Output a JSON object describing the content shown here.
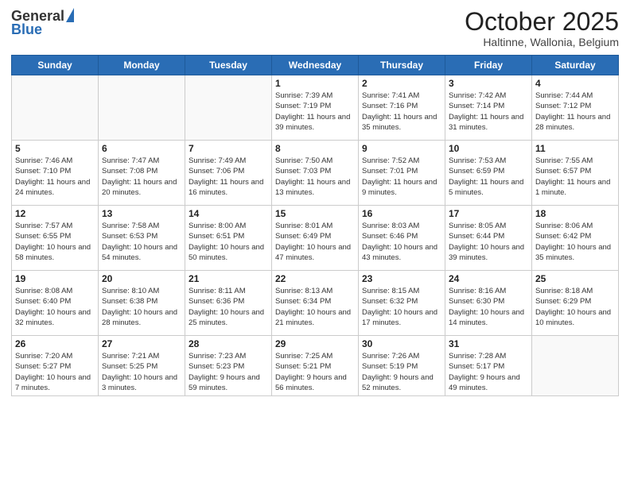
{
  "header": {
    "logo_line1": "General",
    "logo_line2": "Blue",
    "month": "October 2025",
    "location": "Haltinne, Wallonia, Belgium"
  },
  "weekdays": [
    "Sunday",
    "Monday",
    "Tuesday",
    "Wednesday",
    "Thursday",
    "Friday",
    "Saturday"
  ],
  "weeks": [
    [
      {
        "day": "",
        "sunrise": "",
        "sunset": "",
        "daylight": ""
      },
      {
        "day": "",
        "sunrise": "",
        "sunset": "",
        "daylight": ""
      },
      {
        "day": "",
        "sunrise": "",
        "sunset": "",
        "daylight": ""
      },
      {
        "day": "1",
        "sunrise": "Sunrise: 7:39 AM",
        "sunset": "Sunset: 7:19 PM",
        "daylight": "Daylight: 11 hours and 39 minutes."
      },
      {
        "day": "2",
        "sunrise": "Sunrise: 7:41 AM",
        "sunset": "Sunset: 7:16 PM",
        "daylight": "Daylight: 11 hours and 35 minutes."
      },
      {
        "day": "3",
        "sunrise": "Sunrise: 7:42 AM",
        "sunset": "Sunset: 7:14 PM",
        "daylight": "Daylight: 11 hours and 31 minutes."
      },
      {
        "day": "4",
        "sunrise": "Sunrise: 7:44 AM",
        "sunset": "Sunset: 7:12 PM",
        "daylight": "Daylight: 11 hours and 28 minutes."
      }
    ],
    [
      {
        "day": "5",
        "sunrise": "Sunrise: 7:46 AM",
        "sunset": "Sunset: 7:10 PM",
        "daylight": "Daylight: 11 hours and 24 minutes."
      },
      {
        "day": "6",
        "sunrise": "Sunrise: 7:47 AM",
        "sunset": "Sunset: 7:08 PM",
        "daylight": "Daylight: 11 hours and 20 minutes."
      },
      {
        "day": "7",
        "sunrise": "Sunrise: 7:49 AM",
        "sunset": "Sunset: 7:06 PM",
        "daylight": "Daylight: 11 hours and 16 minutes."
      },
      {
        "day": "8",
        "sunrise": "Sunrise: 7:50 AM",
        "sunset": "Sunset: 7:03 PM",
        "daylight": "Daylight: 11 hours and 13 minutes."
      },
      {
        "day": "9",
        "sunrise": "Sunrise: 7:52 AM",
        "sunset": "Sunset: 7:01 PM",
        "daylight": "Daylight: 11 hours and 9 minutes."
      },
      {
        "day": "10",
        "sunrise": "Sunrise: 7:53 AM",
        "sunset": "Sunset: 6:59 PM",
        "daylight": "Daylight: 11 hours and 5 minutes."
      },
      {
        "day": "11",
        "sunrise": "Sunrise: 7:55 AM",
        "sunset": "Sunset: 6:57 PM",
        "daylight": "Daylight: 11 hours and 1 minute."
      }
    ],
    [
      {
        "day": "12",
        "sunrise": "Sunrise: 7:57 AM",
        "sunset": "Sunset: 6:55 PM",
        "daylight": "Daylight: 10 hours and 58 minutes."
      },
      {
        "day": "13",
        "sunrise": "Sunrise: 7:58 AM",
        "sunset": "Sunset: 6:53 PM",
        "daylight": "Daylight: 10 hours and 54 minutes."
      },
      {
        "day": "14",
        "sunrise": "Sunrise: 8:00 AM",
        "sunset": "Sunset: 6:51 PM",
        "daylight": "Daylight: 10 hours and 50 minutes."
      },
      {
        "day": "15",
        "sunrise": "Sunrise: 8:01 AM",
        "sunset": "Sunset: 6:49 PM",
        "daylight": "Daylight: 10 hours and 47 minutes."
      },
      {
        "day": "16",
        "sunrise": "Sunrise: 8:03 AM",
        "sunset": "Sunset: 6:46 PM",
        "daylight": "Daylight: 10 hours and 43 minutes."
      },
      {
        "day": "17",
        "sunrise": "Sunrise: 8:05 AM",
        "sunset": "Sunset: 6:44 PM",
        "daylight": "Daylight: 10 hours and 39 minutes."
      },
      {
        "day": "18",
        "sunrise": "Sunrise: 8:06 AM",
        "sunset": "Sunset: 6:42 PM",
        "daylight": "Daylight: 10 hours and 35 minutes."
      }
    ],
    [
      {
        "day": "19",
        "sunrise": "Sunrise: 8:08 AM",
        "sunset": "Sunset: 6:40 PM",
        "daylight": "Daylight: 10 hours and 32 minutes."
      },
      {
        "day": "20",
        "sunrise": "Sunrise: 8:10 AM",
        "sunset": "Sunset: 6:38 PM",
        "daylight": "Daylight: 10 hours and 28 minutes."
      },
      {
        "day": "21",
        "sunrise": "Sunrise: 8:11 AM",
        "sunset": "Sunset: 6:36 PM",
        "daylight": "Daylight: 10 hours and 25 minutes."
      },
      {
        "day": "22",
        "sunrise": "Sunrise: 8:13 AM",
        "sunset": "Sunset: 6:34 PM",
        "daylight": "Daylight: 10 hours and 21 minutes."
      },
      {
        "day": "23",
        "sunrise": "Sunrise: 8:15 AM",
        "sunset": "Sunset: 6:32 PM",
        "daylight": "Daylight: 10 hours and 17 minutes."
      },
      {
        "day": "24",
        "sunrise": "Sunrise: 8:16 AM",
        "sunset": "Sunset: 6:30 PM",
        "daylight": "Daylight: 10 hours and 14 minutes."
      },
      {
        "day": "25",
        "sunrise": "Sunrise: 8:18 AM",
        "sunset": "Sunset: 6:29 PM",
        "daylight": "Daylight: 10 hours and 10 minutes."
      }
    ],
    [
      {
        "day": "26",
        "sunrise": "Sunrise: 7:20 AM",
        "sunset": "Sunset: 5:27 PM",
        "daylight": "Daylight: 10 hours and 7 minutes."
      },
      {
        "day": "27",
        "sunrise": "Sunrise: 7:21 AM",
        "sunset": "Sunset: 5:25 PM",
        "daylight": "Daylight: 10 hours and 3 minutes."
      },
      {
        "day": "28",
        "sunrise": "Sunrise: 7:23 AM",
        "sunset": "Sunset: 5:23 PM",
        "daylight": "Daylight: 9 hours and 59 minutes."
      },
      {
        "day": "29",
        "sunrise": "Sunrise: 7:25 AM",
        "sunset": "Sunset: 5:21 PM",
        "daylight": "Daylight: 9 hours and 56 minutes."
      },
      {
        "day": "30",
        "sunrise": "Sunrise: 7:26 AM",
        "sunset": "Sunset: 5:19 PM",
        "daylight": "Daylight: 9 hours and 52 minutes."
      },
      {
        "day": "31",
        "sunrise": "Sunrise: 7:28 AM",
        "sunset": "Sunset: 5:17 PM",
        "daylight": "Daylight: 9 hours and 49 minutes."
      },
      {
        "day": "",
        "sunrise": "",
        "sunset": "",
        "daylight": ""
      }
    ]
  ]
}
